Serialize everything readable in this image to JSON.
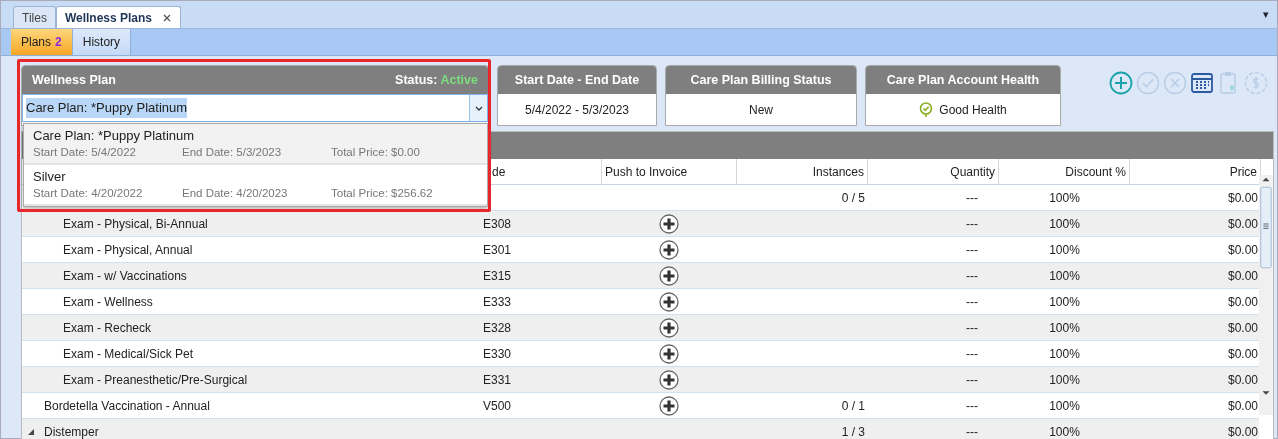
{
  "doc_tabs": [
    {
      "label": "Tiles",
      "selected": false,
      "closable": false
    },
    {
      "label": "Wellness Plans",
      "selected": true,
      "closable": true
    }
  ],
  "doc_menu_glyph": "▾",
  "sub_tabs": [
    {
      "label": "Plans",
      "badge": "2",
      "selected": true
    },
    {
      "label": "History",
      "selected": false
    }
  ],
  "wellness_plan": {
    "title": "Wellness Plan",
    "status_label": "Status:",
    "status": "Active",
    "combo_value": "Care Plan: *Puppy Platinum",
    "text_selected": true,
    "dropdown": [
      {
        "name": "Care Plan: *Puppy Platinum",
        "start": "Start Date: 5/4/2022",
        "end": "End Date: 5/3/2023",
        "total": "Total Price: $0.00",
        "selected": true
      },
      {
        "name": "Silver",
        "start": "Start Date: 4/20/2022",
        "end": "End Date: 4/20/2023",
        "total": "Total Price: $256.62",
        "selected": false
      }
    ]
  },
  "info_cards": [
    {
      "title": "Start Date - End Date",
      "value": "5/4/2022 - 5/3/2023",
      "kind": "text"
    },
    {
      "title": "Care Plan Billing Status",
      "value": "New",
      "kind": "text"
    },
    {
      "title": "Care Plan Account Health",
      "value": "Good Health",
      "kind": "health"
    }
  ],
  "toolbar": [
    {
      "kind": "add",
      "disabled": false
    },
    {
      "kind": "approve",
      "disabled": true
    },
    {
      "kind": "cancel",
      "disabled": true
    },
    {
      "kind": "calendar",
      "disabled": false
    },
    {
      "kind": "clipboard",
      "disabled": true
    },
    {
      "kind": "payment",
      "disabled": true
    }
  ],
  "table": {
    "columns": [
      "de",
      "Push to Invoice",
      "Instances",
      "Quantity",
      "Discount %",
      "Price"
    ],
    "rows": [
      {
        "instances": "0 / 5",
        "quantity": "---",
        "discount": "100%",
        "price": "$0.00",
        "children": [
          {
            "name": "Exam - Physical, Bi-Annual",
            "code": "E308",
            "push": true,
            "quantity": "---",
            "discount": "100%",
            "price": "$0.00"
          },
          {
            "name": "Exam - Physical, Annual",
            "code": "E301",
            "push": true,
            "quantity": "---",
            "discount": "100%",
            "price": "$0.00"
          },
          {
            "name": "Exam - w/ Vaccinations",
            "code": "E315",
            "push": true,
            "quantity": "---",
            "discount": "100%",
            "price": "$0.00"
          },
          {
            "name": "Exam - Wellness",
            "code": "E333",
            "push": true,
            "quantity": "---",
            "discount": "100%",
            "price": "$0.00"
          },
          {
            "name": "Exam - Recheck",
            "code": "E328",
            "push": true,
            "quantity": "---",
            "discount": "100%",
            "price": "$0.00"
          },
          {
            "name": "Exam - Medical/Sick Pet",
            "code": "E330",
            "push": true,
            "quantity": "---",
            "discount": "100%",
            "price": "$0.00"
          },
          {
            "name": "Exam - Preanesthetic/Pre-Surgical",
            "code": "E331",
            "push": true,
            "quantity": "---",
            "discount": "100%",
            "price": "$0.00"
          }
        ]
      },
      {
        "name": "Bordetella Vaccination - Annual",
        "code": "V500",
        "push": true,
        "instances": "0 / 1",
        "quantity": "---",
        "discount": "100%",
        "price": "$0.00"
      },
      {
        "name": "Distemper",
        "expanded": true,
        "instances": "1 / 3",
        "quantity": "---",
        "discount": "100%",
        "price": "$0.00"
      }
    ]
  }
}
